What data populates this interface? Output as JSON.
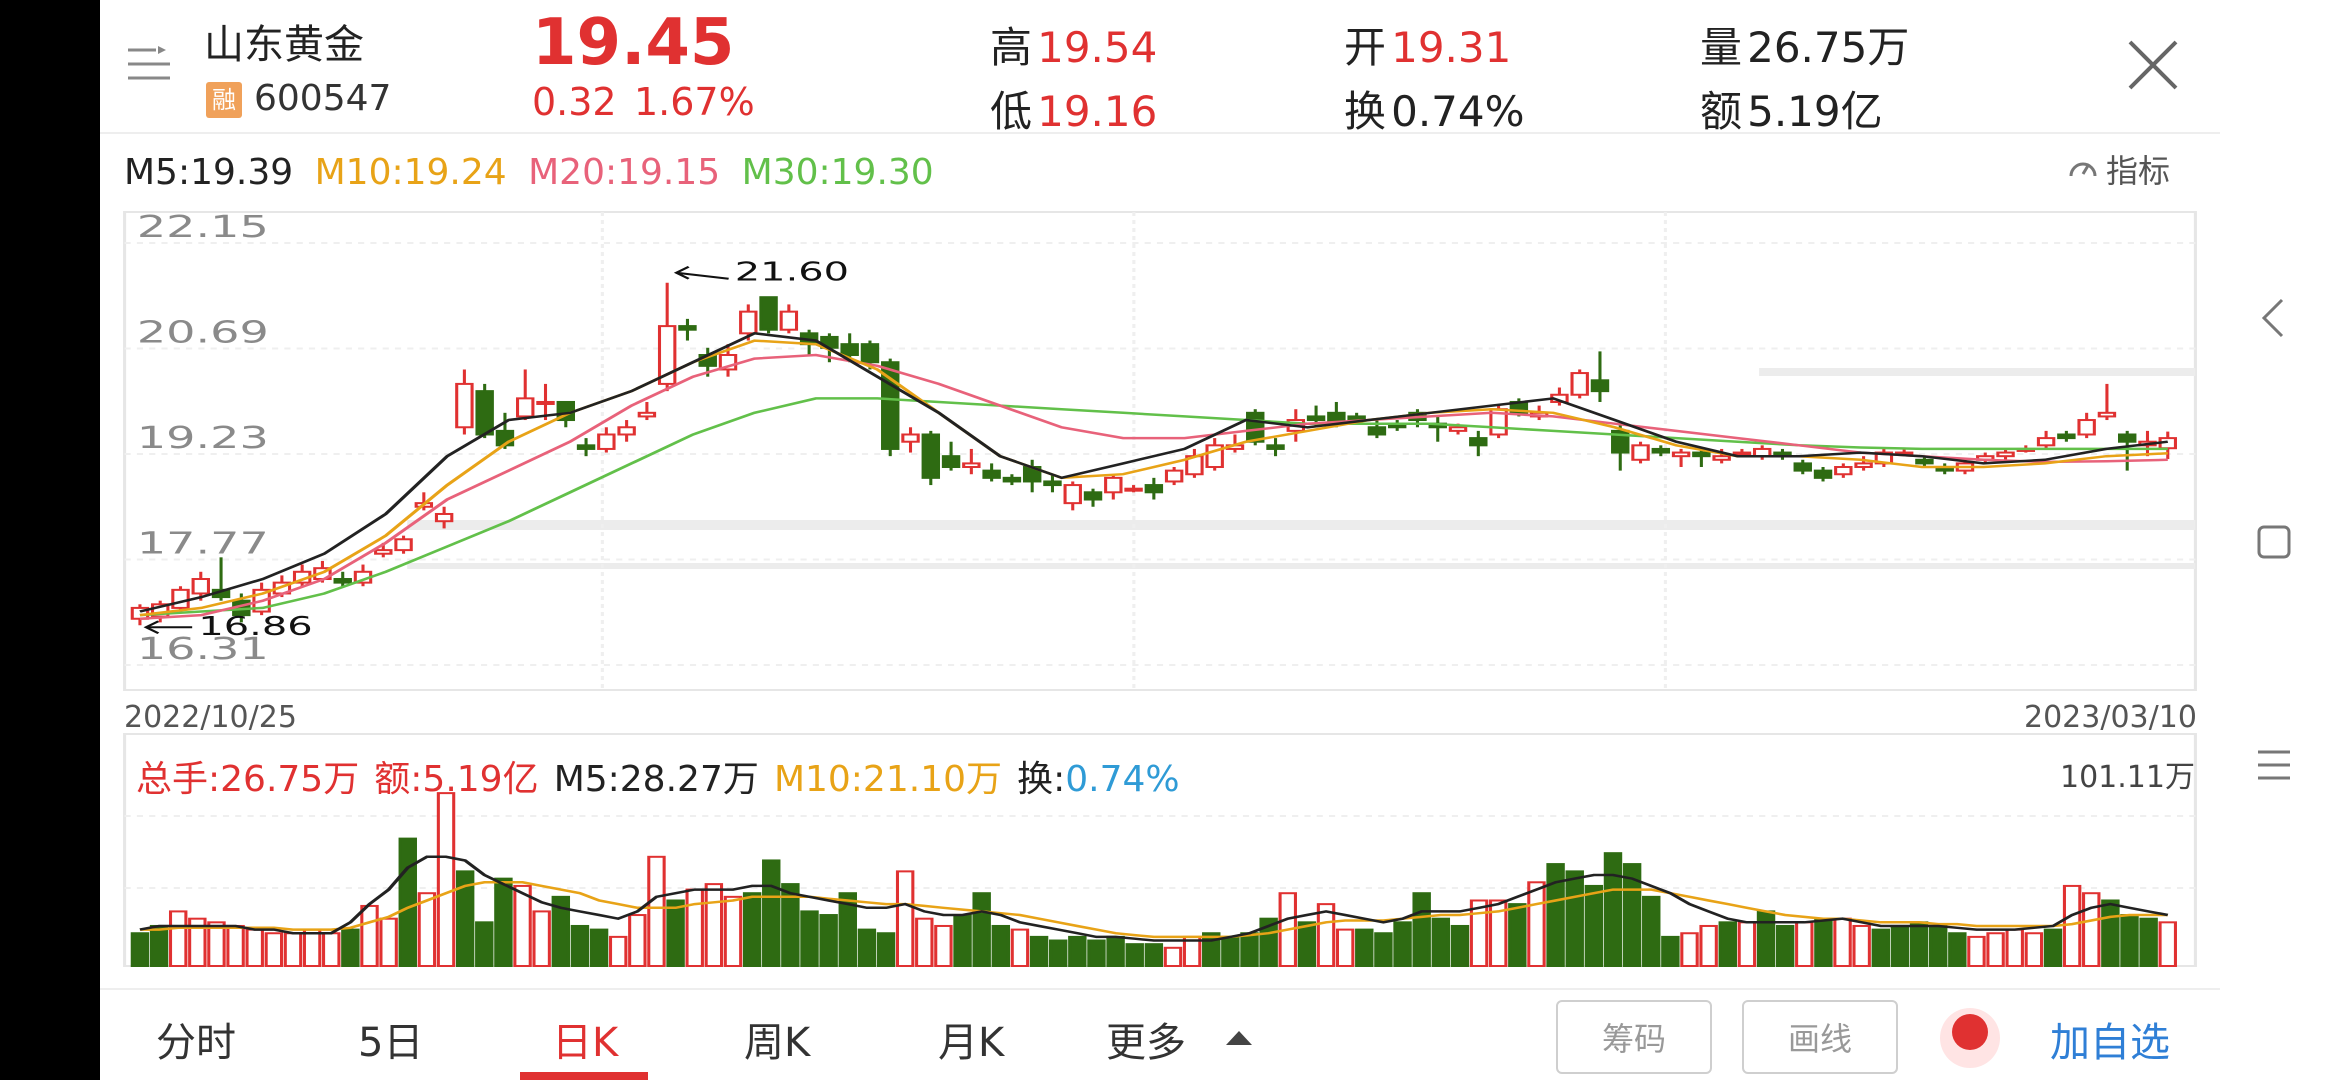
{
  "header": {
    "stock_name": "山东黄金",
    "margin_badge": "融",
    "stock_code": "600547",
    "price": "19.45",
    "change": "0.32",
    "change_pct": "1.67%",
    "high_label": "高",
    "high": "19.54",
    "low_label": "低",
    "low": "19.16",
    "open_label": "开",
    "open": "19.31",
    "turnover_label": "换",
    "turnover": "0.74%",
    "volume_label": "量",
    "volume": "26.75万",
    "amount_label": "额",
    "amount": "5.19亿"
  },
  "ma_legend": {
    "m5": "M5:19.39",
    "m10": "M10:19.24",
    "m20": "M20:19.15",
    "m30": "M30:19.30",
    "indicator": "指标"
  },
  "price_chart": {
    "y_ticks": [
      "22.15",
      "20.69",
      "19.23",
      "17.77",
      "16.31"
    ],
    "max_marker": "21.60",
    "min_marker": "16.86",
    "date_start": "2022/10/25",
    "date_end": "2023/03/10"
  },
  "volume_chart": {
    "total_hands": "总手:26.75万",
    "amount": "额:5.19亿",
    "m5": "M5:28.27万",
    "m10": "M10:21.10万",
    "turnover_label": "换:",
    "turnover_value": "0.74%",
    "max_label": "101.11万"
  },
  "tabs": [
    "分时",
    "5日",
    "日K",
    "周K",
    "月K",
    "更多"
  ],
  "active_tab": "日K",
  "actions": {
    "chips": "筹码",
    "draw": "画线",
    "add_watch": "加自选"
  },
  "colors": {
    "up": "#e03131",
    "down": "#2e6b12",
    "m5": "#222222",
    "m10": "#e8a317",
    "m20": "#e8627a",
    "m30": "#62c04a",
    "turnover_value": "#2f9bd6"
  },
  "chart_data": {
    "type": "candlestick",
    "title": "",
    "x_range": [
      "2022/10/25",
      "2023/03/10"
    ],
    "ylim": [
      16.31,
      22.15
    ],
    "y_ticks": [
      22.15,
      20.69,
      19.23,
      17.77,
      16.31
    ],
    "annotations": {
      "max": 21.6,
      "min": 16.86
    },
    "candles": [
      [
        16.95,
        17.1,
        17.15,
        16.86
      ],
      [
        16.98,
        17.15,
        17.2,
        16.9
      ],
      [
        17.1,
        17.35,
        17.4,
        17.05
      ],
      [
        17.3,
        17.5,
        17.6,
        17.2
      ],
      [
        17.35,
        17.25,
        17.8,
        17.2
      ],
      [
        17.2,
        17.0,
        17.3,
        16.9
      ],
      [
        17.05,
        17.35,
        17.45,
        17.0
      ],
      [
        17.3,
        17.45,
        17.55,
        17.25
      ],
      [
        17.45,
        17.6,
        17.7,
        17.4
      ],
      [
        17.5,
        17.65,
        17.75,
        17.45
      ],
      [
        17.5,
        17.45,
        17.6,
        17.4
      ],
      [
        17.45,
        17.6,
        17.7,
        17.4
      ],
      [
        17.85,
        17.9,
        18.0,
        17.8
      ],
      [
        17.9,
        18.05,
        18.1,
        17.85
      ],
      [
        18.5,
        18.55,
        18.7,
        18.45
      ],
      [
        18.3,
        18.4,
        18.5,
        18.2
      ],
      [
        19.6,
        20.2,
        20.4,
        19.5
      ],
      [
        20.1,
        19.5,
        20.2,
        19.45
      ],
      [
        19.55,
        19.35,
        19.8,
        19.3
      ],
      [
        19.75,
        20.0,
        20.4,
        19.7
      ],
      [
        19.95,
        19.95,
        20.2,
        19.7
      ],
      [
        19.95,
        19.7,
        19.95,
        19.6
      ],
      [
        19.35,
        19.3,
        19.45,
        19.2
      ],
      [
        19.3,
        19.5,
        19.6,
        19.25
      ],
      [
        19.5,
        19.6,
        19.7,
        19.4
      ],
      [
        19.75,
        19.8,
        19.95,
        19.7
      ],
      [
        20.2,
        21.0,
        21.6,
        20.1
      ],
      [
        21.0,
        20.95,
        21.1,
        20.8
      ],
      [
        20.6,
        20.45,
        20.7,
        20.3
      ],
      [
        20.4,
        20.6,
        20.75,
        20.3
      ],
      [
        20.9,
        21.2,
        21.3,
        20.8
      ],
      [
        21.4,
        20.95,
        21.4,
        20.9
      ],
      [
        20.95,
        21.2,
        21.3,
        20.9
      ],
      [
        20.9,
        20.75,
        20.95,
        20.6
      ],
      [
        20.85,
        20.7,
        20.9,
        20.5
      ],
      [
        20.75,
        20.6,
        20.9,
        20.5
      ],
      [
        20.75,
        20.5,
        20.8,
        20.4
      ],
      [
        20.5,
        19.3,
        20.55,
        19.2
      ],
      [
        19.4,
        19.5,
        19.6,
        19.25
      ],
      [
        19.5,
        18.9,
        19.55,
        18.8
      ],
      [
        19.2,
        19.05,
        19.4,
        19.0
      ],
      [
        19.05,
        19.1,
        19.3,
        18.95
      ],
      [
        19.0,
        18.9,
        19.1,
        18.85
      ],
      [
        18.9,
        18.85,
        18.95,
        18.8
      ],
      [
        19.05,
        18.85,
        19.15,
        18.7
      ],
      [
        18.85,
        18.8,
        18.95,
        18.7
      ],
      [
        18.55,
        18.8,
        18.85,
        18.45
      ],
      [
        18.7,
        18.6,
        18.75,
        18.5
      ],
      [
        18.7,
        18.9,
        18.95,
        18.6
      ],
      [
        18.75,
        18.75,
        18.8,
        18.7
      ],
      [
        18.8,
        18.7,
        18.9,
        18.6
      ],
      [
        18.85,
        19.0,
        19.05,
        18.8
      ],
      [
        18.95,
        19.2,
        19.3,
        18.9
      ],
      [
        19.05,
        19.35,
        19.45,
        19.0
      ],
      [
        19.3,
        19.35,
        19.5,
        19.25
      ],
      [
        19.8,
        19.4,
        19.85,
        19.35
      ],
      [
        19.35,
        19.3,
        19.45,
        19.2
      ],
      [
        19.55,
        19.7,
        19.85,
        19.4
      ],
      [
        19.75,
        19.7,
        19.9,
        19.6
      ],
      [
        19.8,
        19.65,
        19.95,
        19.6
      ],
      [
        19.75,
        19.7,
        19.8,
        19.65
      ],
      [
        19.6,
        19.5,
        19.7,
        19.45
      ],
      [
        19.65,
        19.6,
        19.7,
        19.55
      ],
      [
        19.8,
        19.7,
        19.85,
        19.6
      ],
      [
        19.65,
        19.6,
        19.75,
        19.4
      ],
      [
        19.55,
        19.6,
        19.65,
        19.5
      ],
      [
        19.45,
        19.35,
        19.55,
        19.2
      ],
      [
        19.5,
        19.85,
        19.9,
        19.45
      ],
      [
        19.95,
        19.8,
        20.0,
        19.75
      ],
      [
        19.75,
        19.8,
        19.9,
        19.7
      ],
      [
        19.95,
        20.05,
        20.15,
        19.9
      ],
      [
        20.05,
        20.35,
        20.4,
        20.0
      ],
      [
        20.25,
        20.1,
        20.65,
        19.95
      ],
      [
        19.55,
        19.25,
        19.65,
        19.0
      ],
      [
        19.15,
        19.35,
        19.4,
        19.1
      ],
      [
        19.3,
        19.25,
        19.35,
        19.2
      ],
      [
        19.2,
        19.25,
        19.3,
        19.05
      ],
      [
        19.25,
        19.2,
        19.3,
        19.05
      ],
      [
        19.15,
        19.2,
        19.3,
        19.1
      ],
      [
        19.25,
        19.25,
        19.3,
        19.2
      ],
      [
        19.2,
        19.3,
        19.35,
        19.15
      ],
      [
        19.25,
        19.2,
        19.3,
        19.15
      ],
      [
        19.1,
        19.0,
        19.15,
        18.95
      ],
      [
        19.0,
        18.9,
        19.05,
        18.85
      ],
      [
        18.95,
        19.05,
        19.1,
        18.9
      ],
      [
        19.05,
        19.1,
        19.2,
        19.0
      ],
      [
        19.1,
        19.25,
        19.3,
        19.05
      ],
      [
        19.25,
        19.25,
        19.3,
        19.2
      ],
      [
        19.15,
        19.1,
        19.2,
        19.05
      ],
      [
        19.05,
        19.0,
        19.1,
        18.95
      ],
      [
        19.0,
        19.1,
        19.15,
        18.95
      ],
      [
        19.15,
        19.2,
        19.25,
        19.1
      ],
      [
        19.2,
        19.25,
        19.3,
        19.15
      ],
      [
        19.3,
        19.3,
        19.35,
        19.25
      ],
      [
        19.35,
        19.45,
        19.55,
        19.3
      ],
      [
        19.5,
        19.45,
        19.55,
        19.4
      ],
      [
        19.5,
        19.7,
        19.8,
        19.45
      ],
      [
        19.75,
        19.8,
        20.2,
        19.7
      ],
      [
        19.5,
        19.4,
        19.55,
        19.0
      ],
      [
        19.35,
        19.4,
        19.55,
        19.2
      ],
      [
        19.31,
        19.45,
        19.54,
        19.16
      ]
    ],
    "ma_lines": {
      "m5": [
        17.05,
        17.25,
        17.5,
        17.85,
        18.4,
        19.2,
        19.7,
        19.8,
        20.1,
        20.5,
        20.9,
        20.8,
        20.3,
        19.8,
        19.2,
        18.9,
        19.1,
        19.3,
        19.7,
        19.6,
        19.7,
        19.8,
        19.9,
        20.0,
        19.7,
        19.4,
        19.2,
        19.2,
        19.25,
        19.2,
        19.1,
        19.15,
        19.3,
        19.4
      ],
      "m10": [
        17.0,
        17.1,
        17.3,
        17.6,
        18.1,
        18.8,
        19.4,
        19.8,
        20.1,
        20.5,
        20.8,
        20.75,
        20.4,
        19.8,
        19.2,
        18.9,
        18.95,
        19.15,
        19.4,
        19.55,
        19.7,
        19.8,
        19.85,
        19.8,
        19.6,
        19.35,
        19.2,
        19.2,
        19.15,
        19.05,
        19.05,
        19.1,
        19.2,
        19.24
      ],
      "m20": [
        16.95,
        17.0,
        17.2,
        17.5,
        18.0,
        18.6,
        19.0,
        19.4,
        19.9,
        20.3,
        20.55,
        20.6,
        20.45,
        20.2,
        19.9,
        19.6,
        19.45,
        19.45,
        19.55,
        19.65,
        19.7,
        19.75,
        19.8,
        19.75,
        19.65,
        19.55,
        19.45,
        19.35,
        19.25,
        19.2,
        19.15,
        19.12,
        19.13,
        19.15
      ],
      "m30": [
        17.0,
        17.05,
        17.1,
        17.3,
        17.6,
        17.95,
        18.3,
        18.7,
        19.1,
        19.5,
        19.8,
        20.0,
        20.0,
        19.95,
        19.9,
        19.85,
        19.8,
        19.75,
        19.7,
        19.65,
        19.65,
        19.65,
        19.6,
        19.55,
        19.5,
        19.45,
        19.4,
        19.35,
        19.32,
        19.3,
        19.3,
        19.3,
        19.3,
        19.3
      ]
    },
    "volume": {
      "unit": "万",
      "max": 101.11,
      "bars": [
        18,
        22,
        30,
        26,
        24,
        22,
        20,
        18,
        18,
        20,
        18,
        20,
        33,
        26,
        70,
        40,
        95,
        52,
        24,
        48,
        44,
        30,
        38,
        22,
        20,
        16,
        28,
        60,
        36,
        42,
        45,
        38,
        40,
        58,
        45,
        30,
        28,
        40,
        20,
        18,
        52,
        26,
        22,
        28,
        40,
        22,
        20,
        16,
        14,
        16,
        14,
        16,
        12,
        12,
        10,
        16,
        18,
        16,
        18,
        26,
        40,
        24,
        34,
        20,
        20,
        18,
        24,
        40,
        26,
        22,
        36,
        36,
        34,
        46,
        56,
        52,
        44,
        62,
        56,
        38,
        16,
        18,
        22,
        24,
        24,
        30,
        22,
        24,
        26,
        26,
        22,
        20,
        22,
        24,
        22,
        18,
        16,
        18,
        20,
        18,
        20,
        44,
        40,
        36,
        28,
        26,
        24
      ],
      "dir": "ggrrrrrrrrrgrrgrrgggrrgggrrrgrrrggggggggrrrgggrgggggggrrggggrgrrggggggrrgrgggggggrrgrggrgrrgggggrrrrgrrgggr",
      "m5": [
        20,
        22,
        22,
        22,
        22,
        22,
        20,
        20,
        18,
        18,
        18,
        24,
        34,
        42,
        54,
        60,
        60,
        58,
        50,
        45,
        40,
        35,
        32,
        30,
        28,
        26,
        30,
        38,
        40,
        42,
        42,
        42,
        44,
        44,
        40,
        38,
        36,
        34,
        32,
        32,
        34,
        30,
        28,
        28,
        30,
        28,
        24,
        22,
        20,
        18,
        16,
        16,
        15,
        14,
        14,
        14,
        14,
        16,
        18,
        22,
        26,
        28,
        30,
        28,
        26,
        24,
        26,
        30,
        30,
        30,
        32,
        34,
        38,
        42,
        46,
        48,
        50,
        50,
        48,
        44,
        40,
        34,
        30,
        26,
        24,
        24,
        24,
        24,
        25,
        26,
        24,
        22,
        22,
        22,
        22,
        21,
        20,
        20,
        20,
        21,
        22,
        28,
        32,
        34,
        32,
        30,
        28
      ],
      "m10": [
        20,
        20,
        21,
        21,
        21,
        21,
        21,
        21,
        20,
        20,
        20,
        21,
        24,
        27,
        32,
        36,
        40,
        44,
        46,
        46,
        46,
        44,
        42,
        40,
        36,
        34,
        32,
        32,
        32,
        34,
        35,
        36,
        38,
        38,
        38,
        38,
        37,
        36,
        35,
        34,
        34,
        33,
        32,
        31,
        30,
        29,
        28,
        26,
        24,
        22,
        20,
        18,
        17,
        16,
        16,
        16,
        16,
        16,
        17,
        18,
        20,
        22,
        24,
        25,
        25,
        25,
        26,
        27,
        28,
        28,
        29,
        30,
        32,
        34,
        36,
        38,
        40,
        42,
        42,
        42,
        40,
        38,
        36,
        34,
        32,
        30,
        28,
        27,
        26,
        26,
        25,
        24,
        24,
        24,
        23,
        23,
        22,
        22,
        22,
        22,
        22,
        23,
        25,
        27,
        28,
        28,
        28
      ]
    }
  }
}
